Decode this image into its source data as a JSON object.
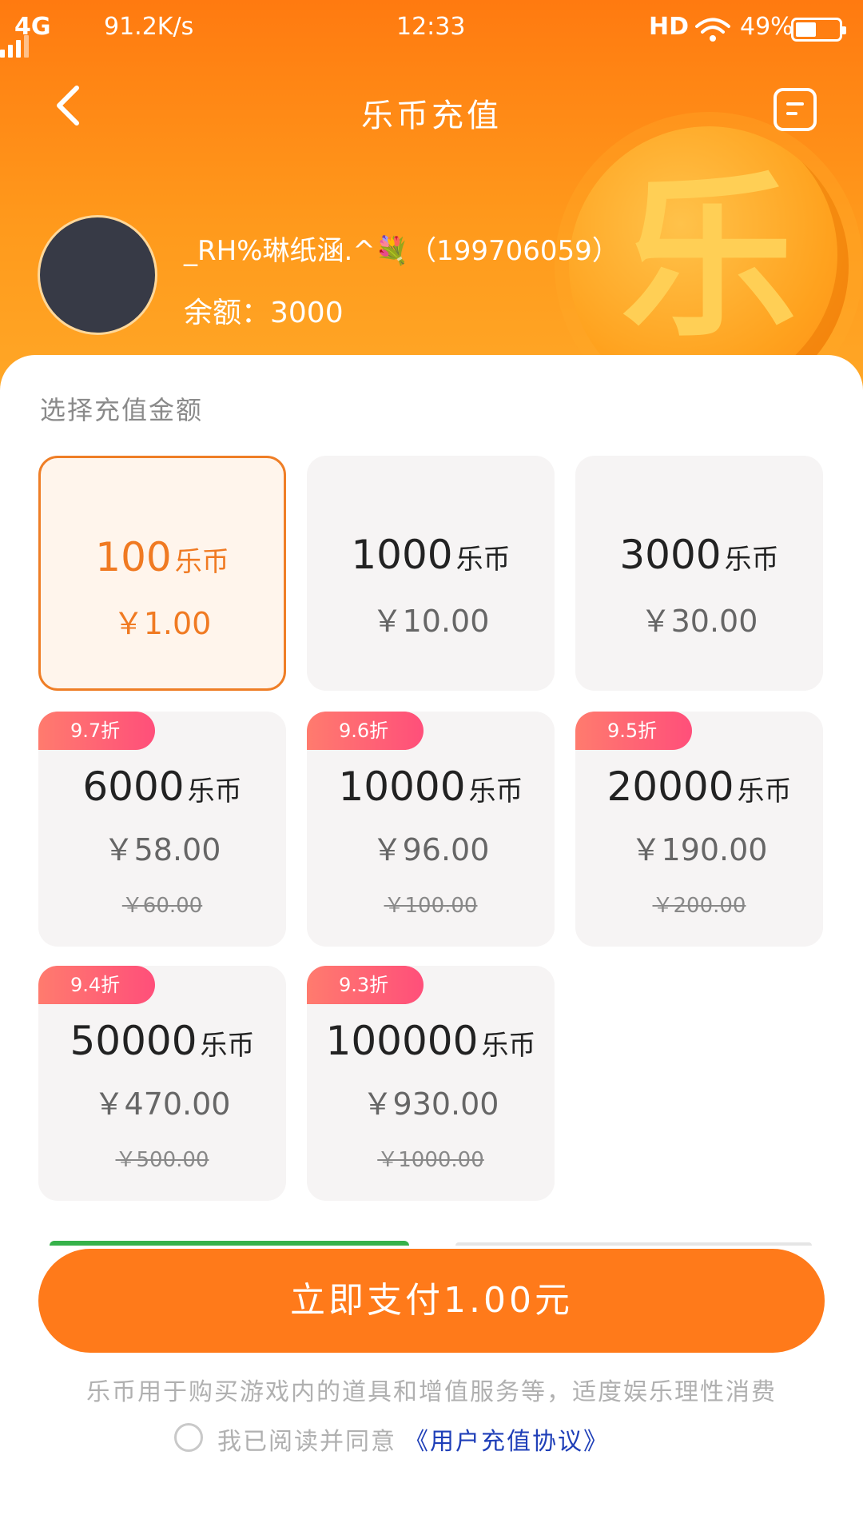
{
  "status_bar": {
    "network": "4G",
    "speed": "91.2K/s",
    "time": "12:33",
    "hd": "HD",
    "battery": "49%",
    "battery_level": 0.49
  },
  "header": {
    "title": "乐币充值",
    "back_icon": "chevron-left-icon",
    "menu_icon": "list-icon",
    "coin_glyph": "乐"
  },
  "user": {
    "name": "_RH%琳纸涵.^💐（199706059）",
    "balance": "余额：3000"
  },
  "section_title": "选择充值金额",
  "packages": [
    {
      "coins": "100",
      "unit": "乐币",
      "price": "￥1.00",
      "selected": true
    },
    {
      "coins": "1000",
      "unit": "乐币",
      "price": "￥10.00"
    },
    {
      "coins": "3000",
      "unit": "乐币",
      "price": "￥30.00"
    },
    {
      "coins": "6000",
      "unit": "乐币",
      "price": "￥58.00",
      "badge": "9.7折",
      "original": "￥60.00"
    },
    {
      "coins": "10000",
      "unit": "乐币",
      "price": "￥96.00",
      "badge": "9.6折",
      "original": "￥100.00"
    },
    {
      "coins": "20000",
      "unit": "乐币",
      "price": "￥190.00",
      "badge": "9.5折",
      "original": "￥200.00"
    },
    {
      "coins": "50000",
      "unit": "乐币",
      "price": "￥470.00",
      "badge": "9.4折",
      "original": "￥500.00"
    },
    {
      "coins": "100000",
      "unit": "乐币",
      "price": "￥930.00",
      "badge": "9.3折",
      "original": "￥1000.00"
    }
  ],
  "pay_button": "立即支付1.00元",
  "note": "乐币用于购买游戏内的道具和增值服务等，适度娱乐理性消费",
  "agreement": {
    "text": "我已阅读并同意",
    "link": "《用户充值协议》"
  },
  "colors": {
    "accent": "#ff7a1a",
    "selected_border": "#ef7e26",
    "badge": "#ff5f78",
    "link": "#1f3fb8"
  }
}
